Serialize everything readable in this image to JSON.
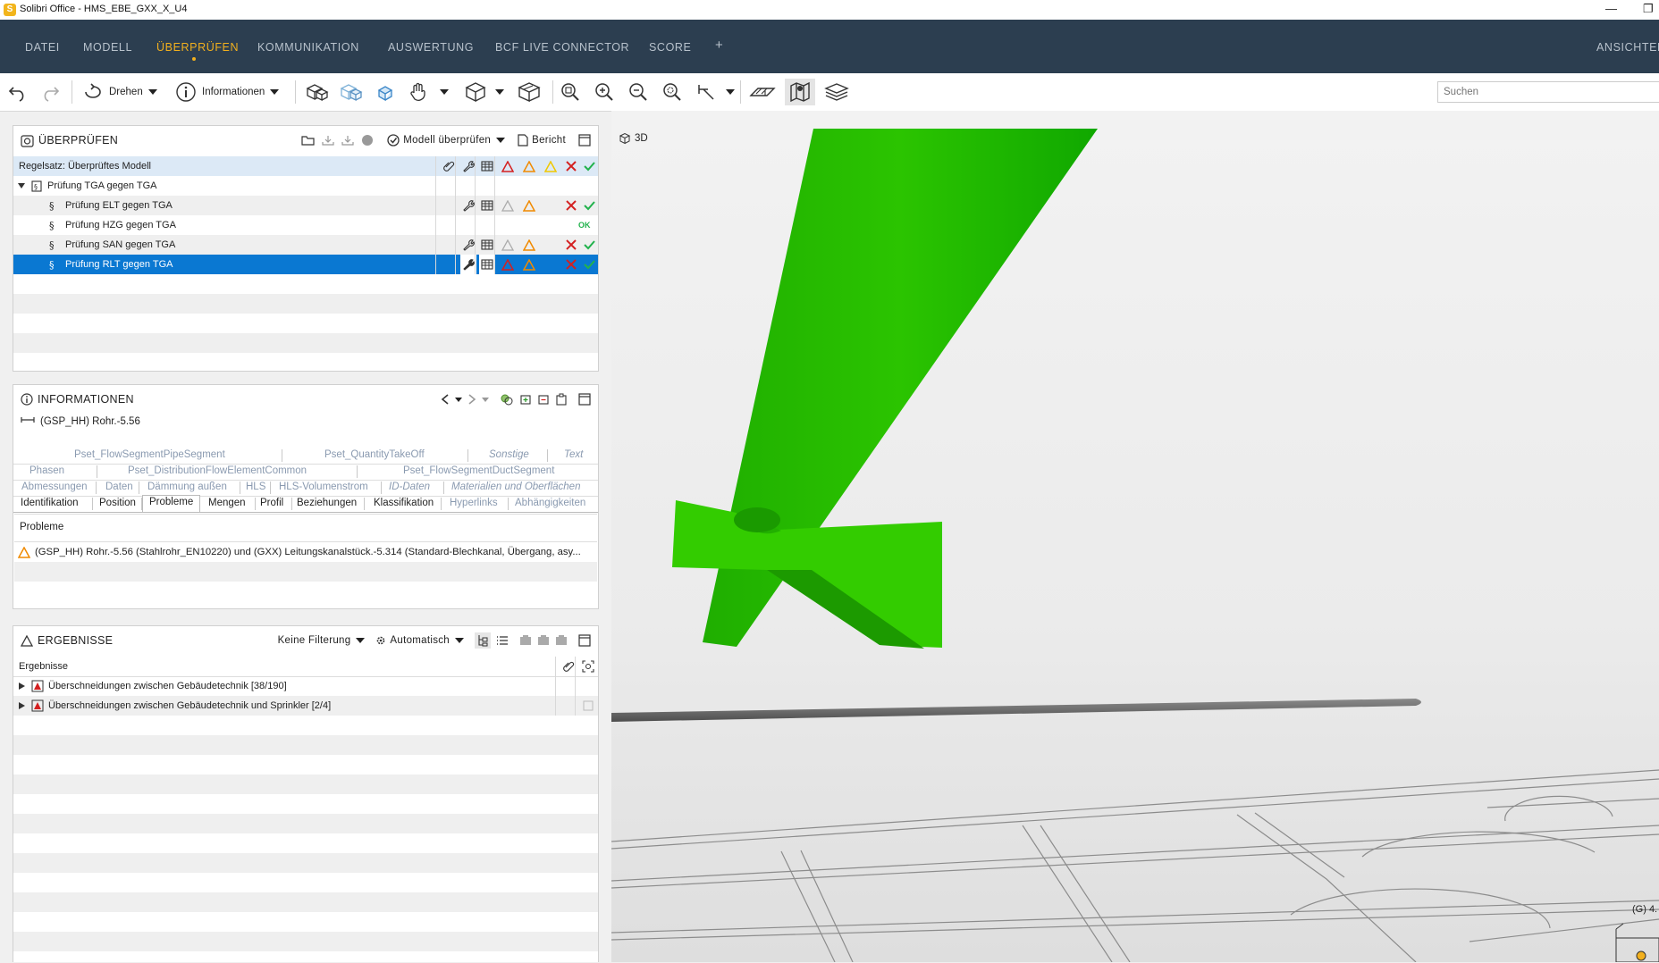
{
  "window": {
    "title": "Solibri Office - HMS_EBE_GXX_X_U4",
    "app_icon_letter": "S",
    "minimize_glyph": "—",
    "restore_glyph": "❐"
  },
  "menu": {
    "items": [
      "DATEI",
      "MODELL",
      "ÜBERPRÜFEN",
      "KOMMUNIKATION",
      "AUSWERTUNG",
      "BCF LIVE CONNECTOR",
      "SCORE"
    ],
    "active": "ÜBERPRÜFEN",
    "add": "+",
    "right": "ANSICHTEN"
  },
  "toolbar": {
    "rotate_label": "Drehen",
    "info_label": "Informationen",
    "search_placeholder": "Suchen",
    "icons": [
      "undo-icon",
      "redo-icon",
      "rotate-icon",
      "info-icon",
      "model-box-icon",
      "transparent-box-icon",
      "selection-box-icon",
      "hand-icon",
      "view-cube-icon",
      "section-box-icon",
      "zoom-fit-icon",
      "zoom-in-icon",
      "zoom-out-icon",
      "zoom-selected-icon",
      "measure-icon",
      "floor-plan-icon",
      "map-icon",
      "layers-icon"
    ]
  },
  "check_panel": {
    "title": "ÜBERPRÜFEN",
    "check_model_label": "Modell überprüfen",
    "report_label": "Bericht",
    "ruleset_label": "Regelsatz: Überprüftes Modell",
    "parent": "Prüfung TGA gegen TGA",
    "rules": [
      {
        "name": "Prüfung ELT gegen TGA",
        "status": "issues"
      },
      {
        "name": "Prüfung HZG gegen TGA",
        "status": "ok",
        "ok_label": "OK"
      },
      {
        "name": "Prüfung SAN gegen TGA",
        "status": "issues"
      },
      {
        "name": "Prüfung RLT gegen TGA",
        "status": "issues",
        "selected": true
      }
    ]
  },
  "info_panel": {
    "title": "INFORMATIONEN",
    "object": "(GSP_HH) Rohr.-5.56",
    "tab_rows": [
      [
        "Pset_FlowSegmentPipeSegment",
        "Pset_QuantityTakeOff",
        "Sonstige",
        "Text"
      ],
      [
        "Phasen",
        "Pset_DistributionFlowElementCommon",
        "Pset_FlowSegmentDuctSegment"
      ],
      [
        "Abmessungen",
        "Daten",
        "Dämmung außen",
        "HLS",
        "HLS-Volumenstrom",
        "ID-Daten",
        "Materialien und Oberflächen"
      ],
      [
        "Identifikation",
        "Position",
        "Probleme",
        "Mengen",
        "Profil",
        "Beziehungen",
        "Klassifikation",
        "Hyperlinks",
        "Abhängigkeiten"
      ]
    ],
    "active_tab": "Probleme",
    "problems_header": "Probleme",
    "problem_text": "(GSP_HH) Rohr.-5.56 (Stahlrohr_EN10220) und (GXX) Leitungskanalstück.-5.314 (Standard-Blechkanal, Übergang, asy..."
  },
  "results_panel": {
    "title": "ERGEBNISSE",
    "filter_label": "Keine Filterung",
    "auto_label": "Automatisch",
    "header": "Ergebnisse",
    "items": [
      "Überschneidungen zwischen Gebäudetechnik [38/190]",
      "Überschneidungen zwischen Gebäudetechnik und Sprinkler [2/4]"
    ]
  },
  "view3d": {
    "label": "3D",
    "corner_label": "(G) 4.",
    "colors": {
      "duct_light": "#33cc00",
      "duct_dark": "#1fae00",
      "pipe": "#6d6d6d"
    }
  },
  "colors": {
    "menu_bg": "#2c3e50",
    "accent": "#f2b01e",
    "selection": "#0a78d2",
    "critical": "#d42020",
    "moderate": "#f08a00",
    "low": "#f0c800",
    "ok": "#22b24c"
  }
}
